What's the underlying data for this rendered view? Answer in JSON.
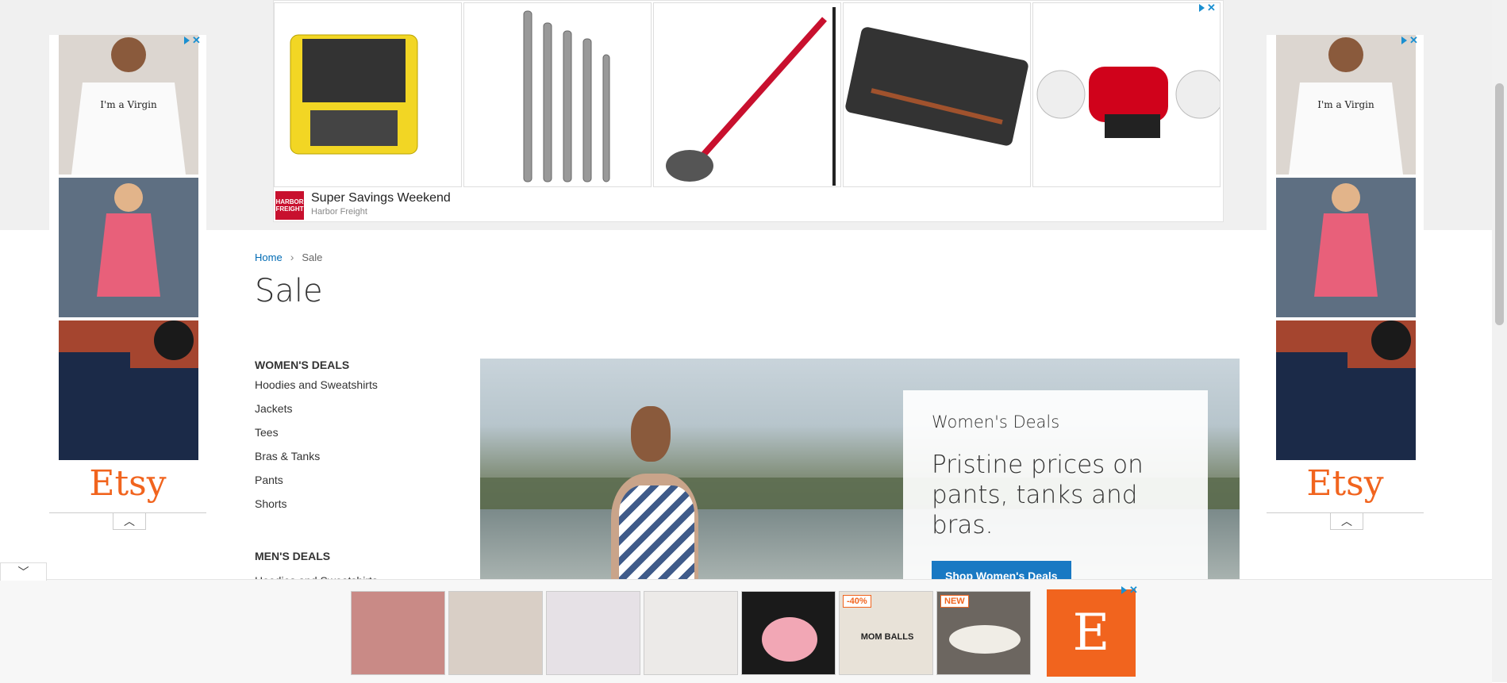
{
  "top_ad": {
    "headline": "Super Savings Weekend",
    "advertiser": "Harbor Freight",
    "brand_logo_text": "HARBOR FREIGHT",
    "products": [
      "yellow-hard-case",
      "ratcheting-wrench-set",
      "drywall-sander",
      "rifle-hard-case",
      "bench-buffer"
    ]
  },
  "side_ad": {
    "logo_text": "Etsy",
    "items": [
      "tshirt-im-a-virgin",
      "pink-dress-photo",
      "west-virginia-tshirt"
    ],
    "shirt_text": "I'm a Virgin"
  },
  "breadcrumb": {
    "home": "Home",
    "current": "Sale"
  },
  "page_title": "Sale",
  "nav": {
    "womens_heading": "WOMEN'S DEALS",
    "womens_items": [
      "Hoodies and Sweatshirts",
      "Jackets",
      "Tees",
      "Bras & Tanks",
      "Pants",
      "Shorts"
    ],
    "mens_heading": "MEN'S DEALS",
    "mens_first_item": "Hoodies and Sweatshirts"
  },
  "hero": {
    "kicker": "Women's Deals",
    "headline": "Pristine prices on pants, tanks and bras.",
    "button_label": "Shop Women's Deals"
  },
  "bottom_ad": {
    "badges": {
      "discount": "-40%",
      "new": "NEW"
    },
    "shirt_text": "MOM BALLS",
    "logo_letter": "E"
  },
  "colors": {
    "link": "#006bb4",
    "primary_button": "#1979c3",
    "etsy_orange": "#f1641e",
    "harbor_red": "#c8102e"
  }
}
